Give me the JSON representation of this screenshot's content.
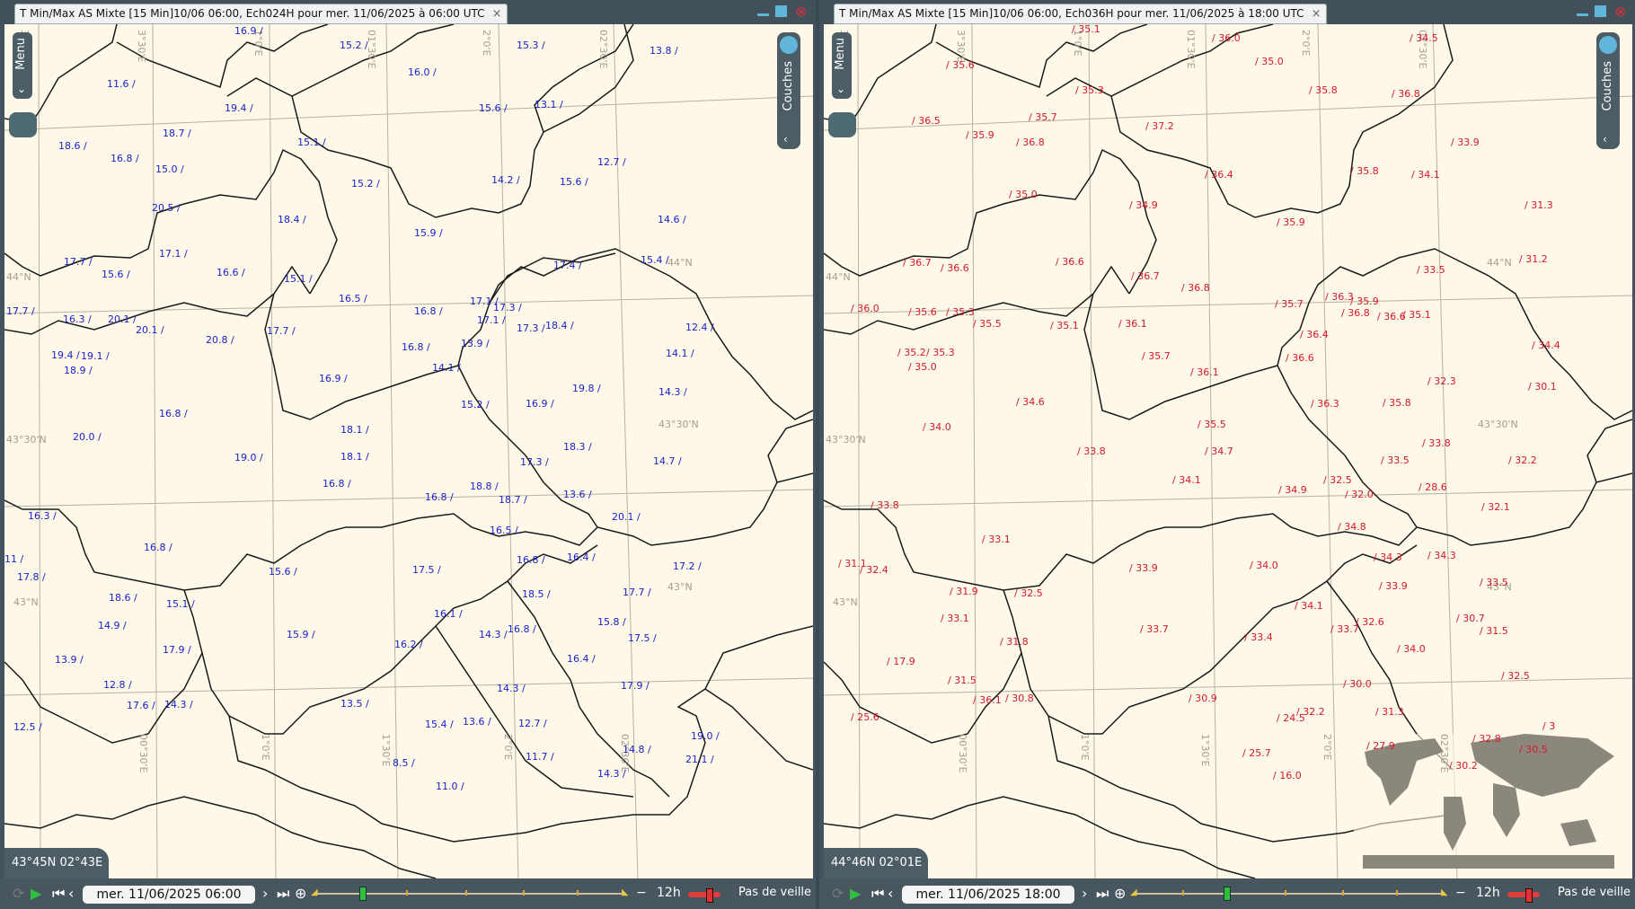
{
  "left": {
    "title": "T Min/Max AS Mixte [15 Min]10/06 06:00, Ech024H pour mer. 11/06/2025 à 06:00 UTC",
    "close": "×",
    "menu": "Menu",
    "layers": "Couches",
    "coords": "43°45N 02°43E",
    "date": "mer. 11/06/2025 06:00",
    "step": "12h",
    "veille": "Pas de veille",
    "grid": [
      "3°0'E",
      "3°30'E",
      "1°0'E",
      "01°30'E",
      "2°0'E",
      "02°30'E",
      "44°N",
      "44°N",
      "43°30'N",
      "43°30'N",
      "43°N",
      "43°N",
      "00°30'E",
      "1°0'E",
      "1°30'E",
      "2°0'E",
      "02°30'E"
    ],
    "values": [
      "16.9 /",
      "15.2 /",
      "15.3 /",
      "13.8 /",
      "16.0 /",
      "11.6 /",
      "19.4 /",
      "15.6 /",
      "13.1 /",
      "18.6 /",
      "18.7 /",
      "15.1 /",
      "12.7 /",
      "16.8 /",
      "15.0 /",
      "14.2 /",
      "15.6 /",
      "15.2 /",
      "20.5 /",
      "18.4 /",
      "15.9 /",
      "14.6 /",
      "17.1 /",
      "17.7 /",
      "15.6 /",
      "16.6 /",
      "15.1 /",
      "17.4 /",
      "15.4 /",
      "16.5 /",
      "17.7 /",
      "17.1 /",
      "17.3 /",
      "16.8 /",
      "16.3 /",
      "20.1 /",
      "17.1 /",
      "20.1 /",
      "17.7 /",
      "17.3 /",
      "18.4 /",
      "12.4 /",
      "20.8 /",
      "13.9 /",
      "19.4 /",
      "19.1 /",
      "16.8 /",
      "14.1 /",
      "14.1 /",
      "18.9 /",
      "16.9 /",
      "19.8 /",
      "15.2 /",
      "16.9 /",
      "14.3 /",
      "16.8 /",
      "20.0 /",
      "18.1 /",
      "18.3 /",
      "19.0 /",
      "18.1 /",
      "17.3 /",
      "14.7 /",
      "16.8 /",
      "18.8 /",
      "16.8 /",
      "18.7 /",
      "13.6 /",
      "16.3 /",
      "20.1 /",
      "16.5 /",
      "16.8 /",
      "16.4 /",
      "17.8 /",
      "15.6 /",
      "16.8 /",
      "17.2 /",
      "18.6 /",
      "17.5 /",
      "15.1 /",
      "16.1 /",
      "18.5 /",
      "17.7 /",
      "14.9 /",
      "15.9 /",
      "14.3 /",
      "16.8 /",
      "15.8 /",
      "16.2 /",
      "17.5 /",
      "17.9 /",
      "16.4 /",
      "13.9 /",
      "12.8 /",
      "14.3 /",
      "17.9 /",
      "17.6 /",
      "14.3 /",
      "13.5 /",
      "12.5 /",
      "15.4 /",
      "13.6 /",
      "12.7 /",
      "19.0 /",
      "14.8 /",
      "8.5 /",
      "11.7 /",
      "21.1 /",
      "11.0 /",
      "14.3 /",
      "11 /"
    ]
  },
  "right": {
    "title": "T Min/Max AS Mixte [15 Min]10/06 06:00, Ech036H pour mer. 11/06/2025 à 18:00 UTC",
    "close": "×",
    "menu": "Menu",
    "layers": "Couches",
    "coords": "44°46N 02°01E",
    "date": "mer. 11/06/2025 18:00",
    "step": "12h",
    "veille": "Pas de veille",
    "grid": [
      "3°0'E",
      "3°30'E",
      "1°0'E",
      "01°30'E",
      "2°0'E",
      "02°30'E",
      "44°N",
      "44°N",
      "43°30'N",
      "43°30'N",
      "43°N",
      "43°N",
      "00°30'E",
      "1°0'E",
      "1°30'E",
      "2°0'E",
      "02°30'E"
    ],
    "values": [
      "/ 35.1",
      "/ 36.0",
      "/ 34.5",
      "/ 35.6",
      "/ 35.0",
      "/ 35.3",
      "/ 35.8",
      "/ 36.8",
      "/ 36.5",
      "/ 35.7",
      "/ 37.2",
      "/ 36",
      "/ 35.9",
      "/ 36.8",
      "/ 33.9",
      "/ 35.8",
      "/ 34.1",
      "/ 36.4",
      "/ 35.0",
      "/ 34.9",
      "/ 31.3",
      "/ 35.9",
      "/ 36.7",
      "/ 36.6",
      "/ 36.6",
      "/ 36.7",
      "/ 31.2",
      "/ 33.5",
      "/ 36.8",
      "/ 36.0",
      "/ 35.6",
      "/ 35.3",
      "/ 36.3",
      "/ 35.9",
      "/ 35.7",
      "/ 36.8",
      "/ 35.5",
      "/ 36.1",
      "/ 36.6",
      "/ 35.1",
      "/ 35.1",
      "/ 36.4",
      "/ 35.2",
      "/ 35.3",
      "/ 34.4",
      "/ 35.7",
      "/ 35.0",
      "/ 36.6",
      "/ 36.1",
      "/ 32.3",
      "/ 30.1",
      "/ 34.6",
      "/ 36.3",
      "/ 35.8",
      "/ 34.0",
      "/ 35.5",
      "/ 33.8",
      "/ 33.8",
      "/ 34.7",
      "/ 33.5",
      "/ 32.2",
      "/ 34.1",
      "/ 32.5",
      "/ 28.6",
      "/ 34.9",
      "/ 32.0",
      "/ 33.8",
      "/ 32.1",
      "/ 34.8",
      "/ 33.1",
      "/ 31.1",
      "/ 34.3",
      "/ 34.3",
      "/ 33.9",
      "/ 34.0",
      "/ 32.4",
      "/ 33.5",
      "/ 33.9",
      "/ 31.9",
      "/ 32.5",
      "/ 34.1",
      "/ 33.1",
      "/ 32.6",
      "/ 30.7",
      "/ 33.7",
      "/ 33.7",
      "/ 31.5",
      "/ 31.8",
      "/ 33.4",
      "/ 34.0",
      "/ 17.9",
      "/ 32.5",
      "/ 31.5",
      "/ 30.0",
      "/ 36.1",
      "/ 30.8",
      "/ 30.9",
      "/ 31.3",
      "/ 32.2",
      "/ 25.6",
      "/ 24.5",
      "/ 32.8",
      "/ 27.9",
      "/ 30.5",
      "/ 25.7",
      "/ 30.2",
      "/ 16.0",
      "/ 3"
    ]
  }
}
